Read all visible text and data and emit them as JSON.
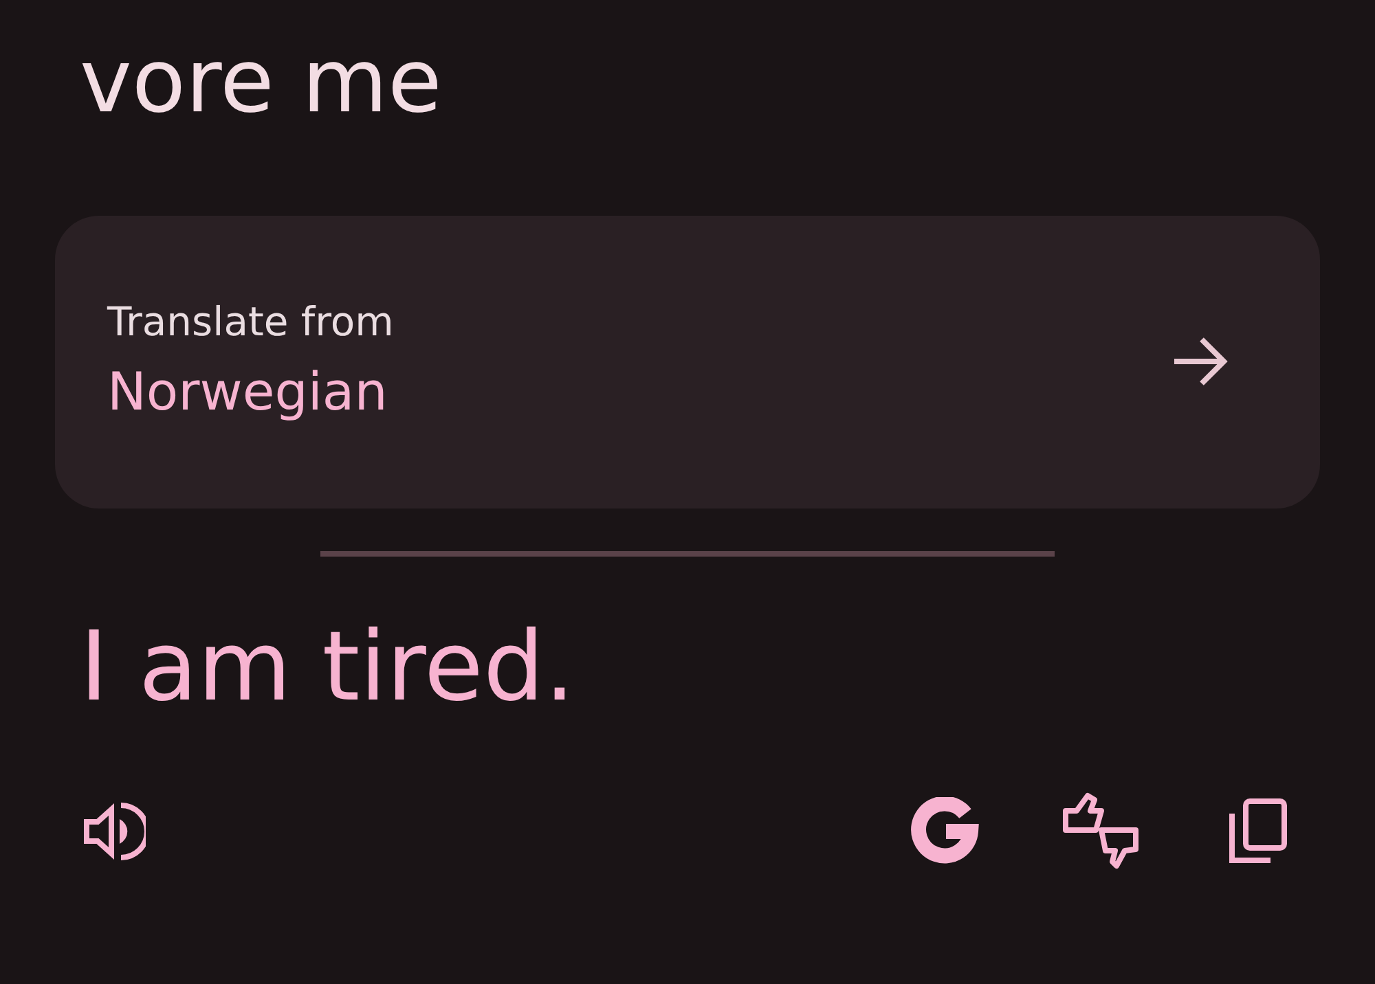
{
  "source_text": "vore me",
  "language_card": {
    "label": "Translate from",
    "language": "Norwegian"
  },
  "translation": "I am tired."
}
